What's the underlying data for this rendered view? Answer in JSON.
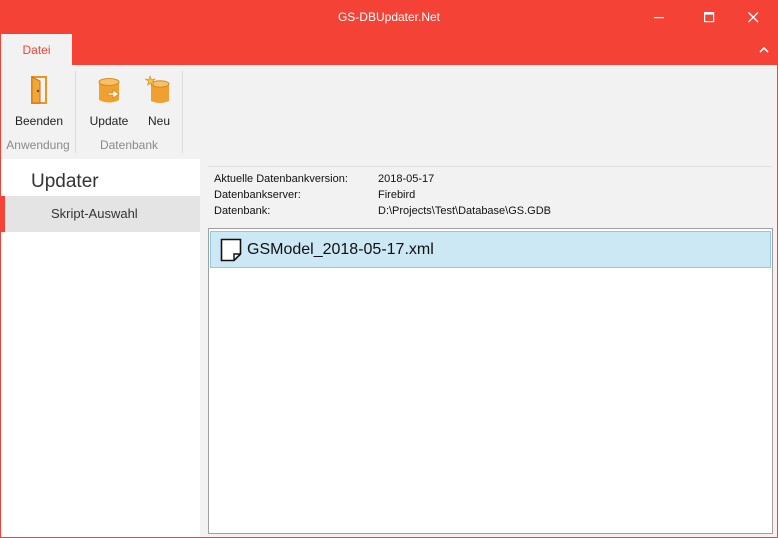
{
  "window": {
    "title": "GS-DBUpdater.Net"
  },
  "ribbon": {
    "tab_label": "Datei",
    "groups": [
      {
        "label": "Anwendung",
        "buttons": [
          {
            "label": "Beenden",
            "icon": "exit-door-icon"
          }
        ]
      },
      {
        "label": "Datenbank",
        "buttons": [
          {
            "label": "Update",
            "icon": "database-update-icon"
          },
          {
            "label": "Neu",
            "icon": "database-new-icon"
          }
        ]
      }
    ]
  },
  "nav": {
    "title": "Updater",
    "items": [
      {
        "label": "Skript-Auswahl",
        "selected": true
      }
    ]
  },
  "info": [
    {
      "key": "Aktuelle Datenbankversion:",
      "value": "2018-05-17"
    },
    {
      "key": "Datenbankserver:",
      "value": "Firebird"
    },
    {
      "key": "Datenbank:",
      "value": "D:\\Projects\\Test\\Database\\GS.GDB"
    }
  ],
  "scripts": [
    {
      "name": "GSModel_2018-05-17.xml",
      "selected": true,
      "icon": "file-icon"
    }
  ],
  "colors": {
    "accent": "#f44336",
    "selection": "#cce8f4",
    "selection_border": "#90c8e6"
  }
}
